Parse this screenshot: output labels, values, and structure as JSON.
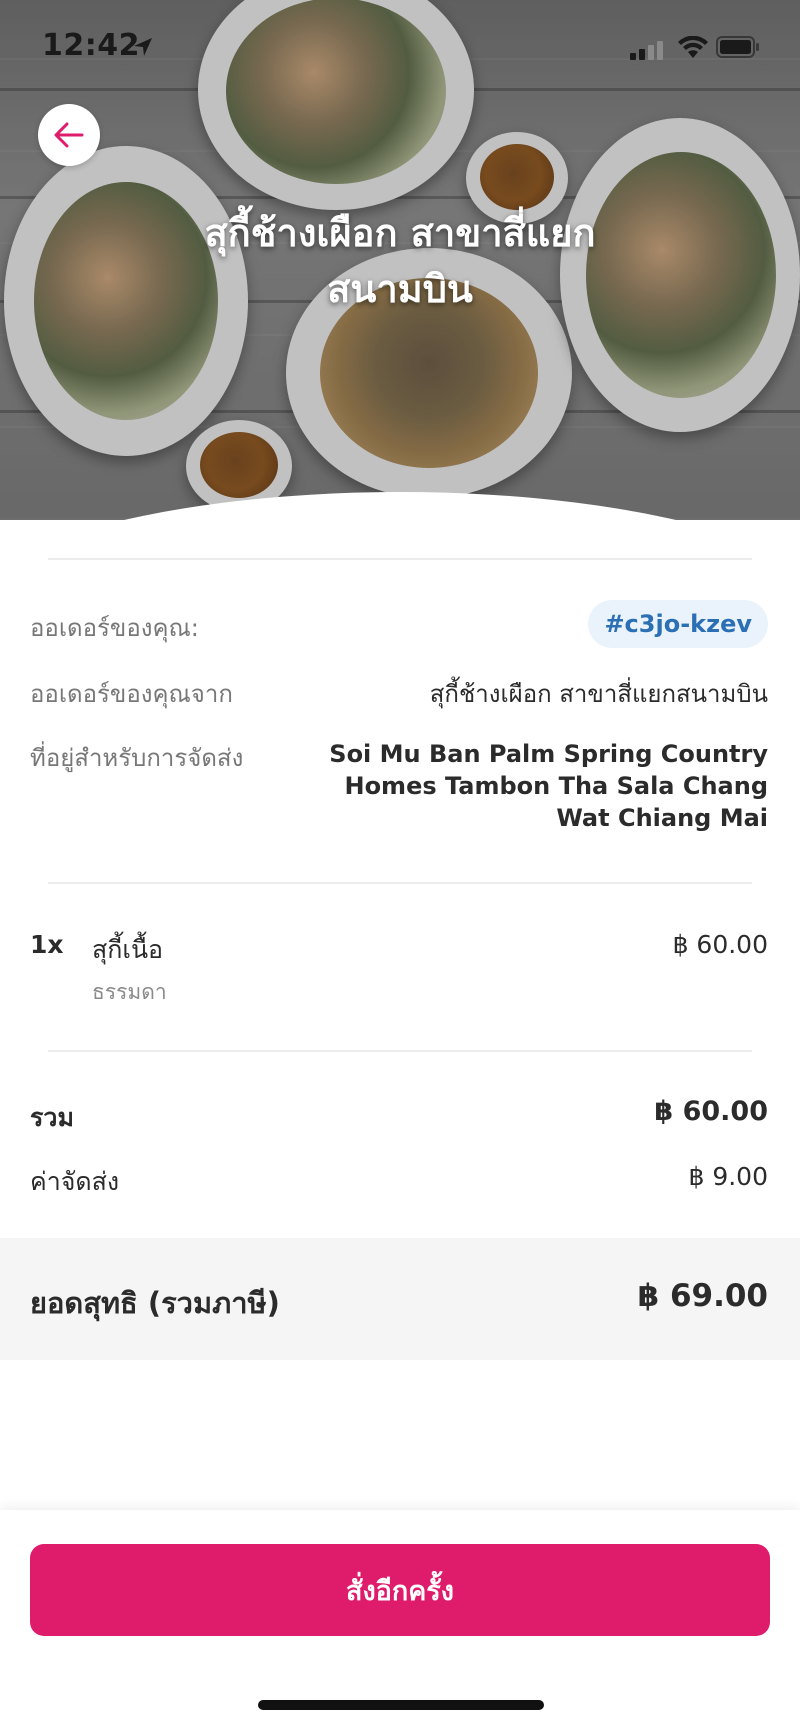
{
  "status_bar": {
    "time": "12:42"
  },
  "restaurant": {
    "title_line1": "สุกี้ช้างเผือก สาขาสี่แยก",
    "title_line2": "สนามบิน"
  },
  "order": {
    "id_label": "ออเดอร์ของคุณ:",
    "id": "#c3jo-kzev",
    "from_label": "ออเดอร์ของคุณจาก",
    "from_value": "สุกี้ช้างเผือก สาขาสี่แยกสนามบิน",
    "address_label": "ที่อยู่สำหรับการจัดส่ง",
    "address_line1": "Soi Mu Ban Palm Spring Country",
    "address_line2": "Homes Tambon Tha Sala Chang",
    "address_line3": "Wat Chiang Mai"
  },
  "items": [
    {
      "qty": "1x",
      "name": "สุกี้เนื้อ",
      "option": "ธรรมดา",
      "price": "฿ 60.00"
    }
  ],
  "summary": {
    "subtotal_label": "รวม",
    "subtotal_value": "฿ 60.00",
    "delivery_label": "ค่าจัดส่ง",
    "delivery_value": "฿ 9.00",
    "total_label": "ยอดสุทธิ (รวมภาษี)",
    "total_value": "฿ 69.00"
  },
  "actions": {
    "reorder_label": "สั่งอีกครั้ง"
  },
  "colors": {
    "brand": "#df1b6b",
    "badge_bg": "#eaf2fb",
    "badge_text": "#2b6fb5"
  }
}
